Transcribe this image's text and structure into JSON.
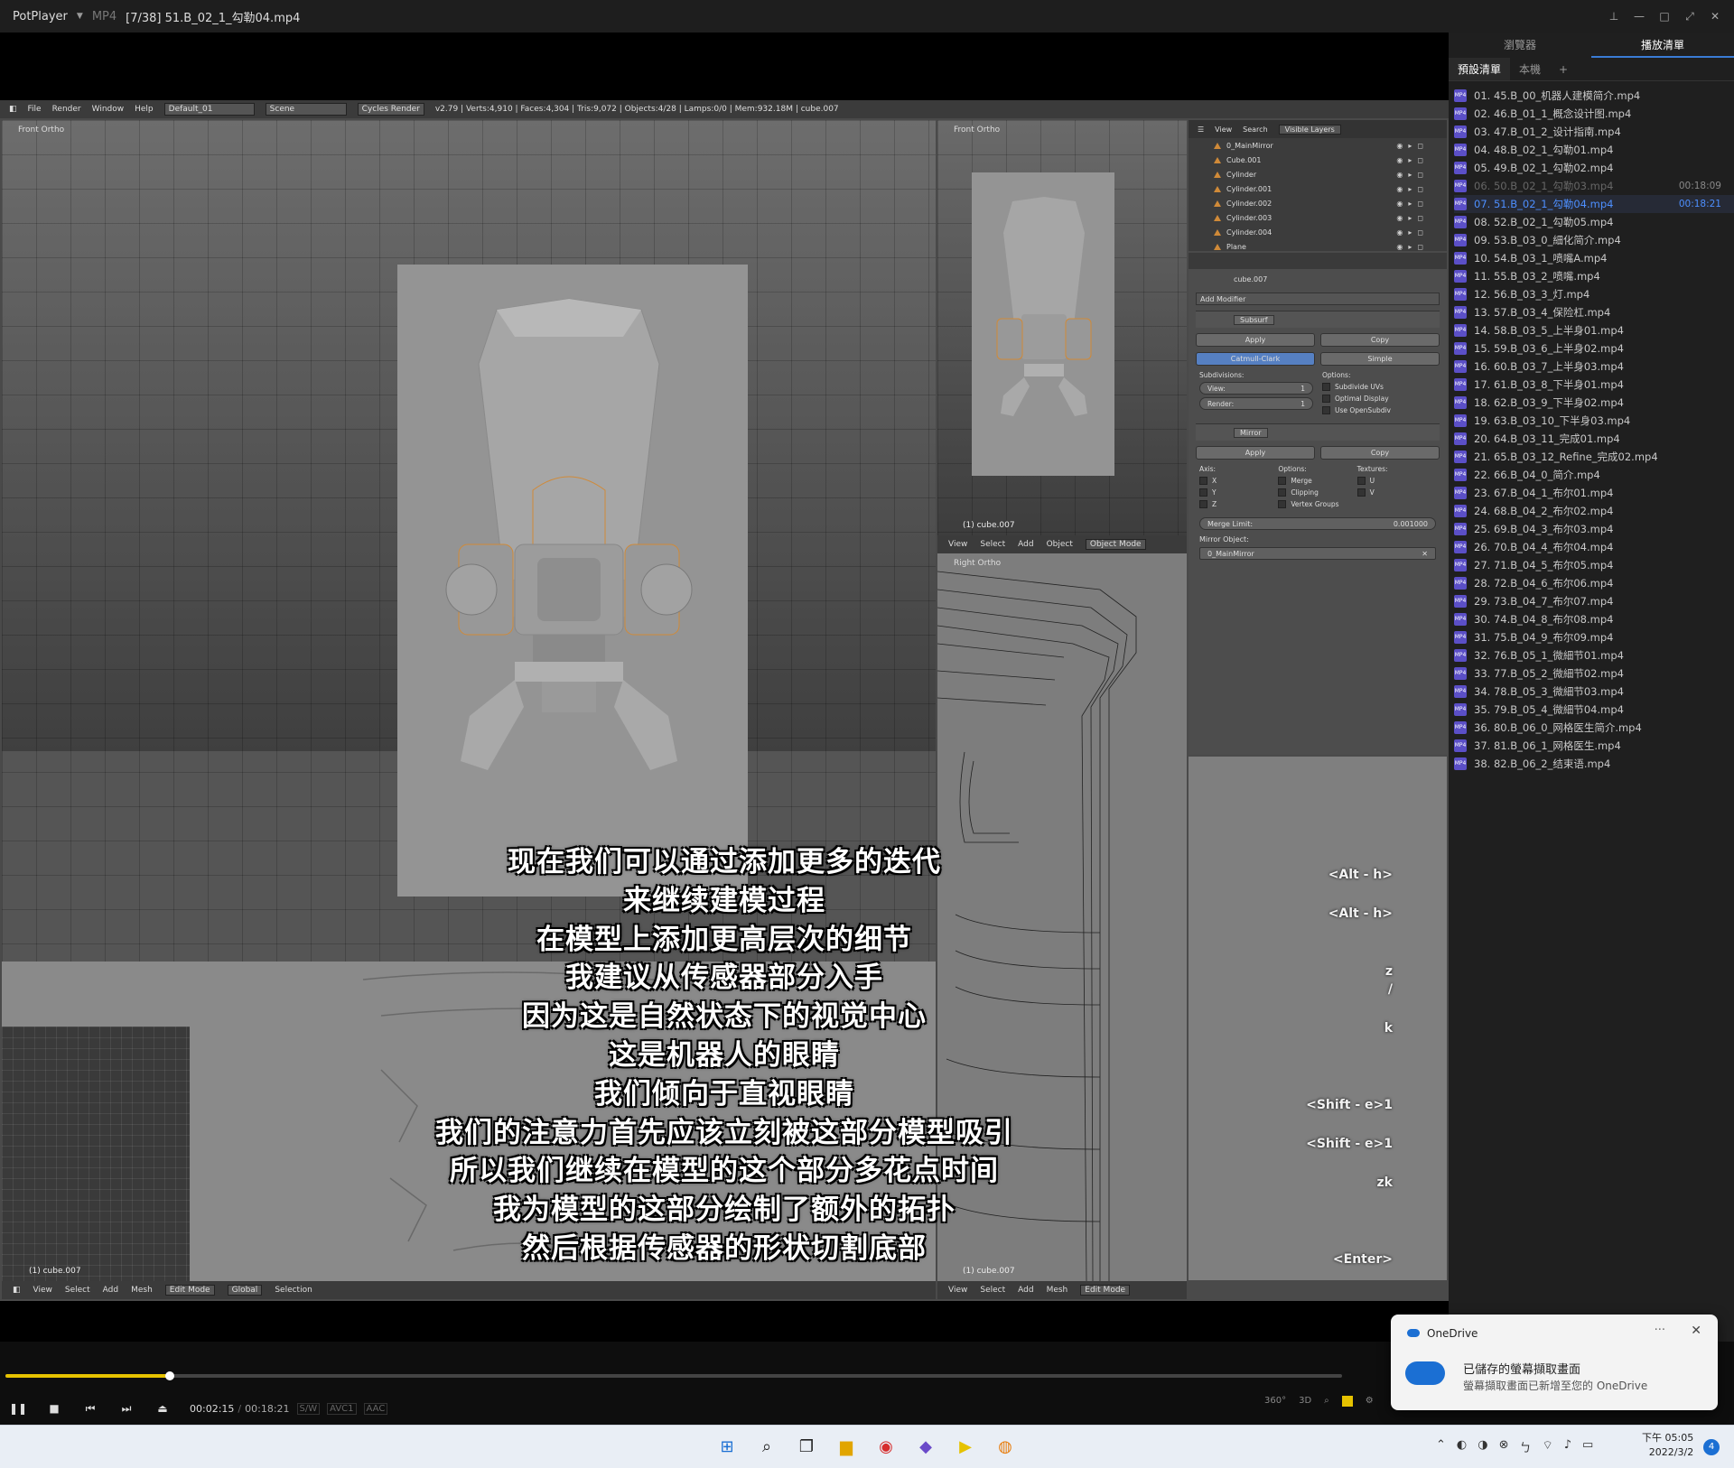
{
  "titlebar": {
    "app_name": "PotPlayer",
    "format": "MP4",
    "file_title": "[7/38] 51.B_02_1_勾勒04.mp4"
  },
  "blender": {
    "header": {
      "menus": [
        "File",
        "Render",
        "Window",
        "Help"
      ],
      "screen": "Default_01",
      "scene": "Scene",
      "engine": "Cycles Render",
      "stats": "v2.79 | Verts:4,910 | Faces:4,304 | Tris:9,072 | Objects:4/28 | Lamps:0/0 | Mem:932.18M | cube.007"
    },
    "viewport_main_label": "Front Ortho",
    "viewport_side_label": "Front Ortho",
    "viewport_side_footer": "(1) cube.007",
    "viewport_right_label": "Right Ortho",
    "viewport_right_footer": "(1) cube.007",
    "small_viewport_footer": "(1) cube.007",
    "right_viewport_header": {
      "items": [
        "View",
        "Select",
        "Add",
        "Object"
      ],
      "mode": "Object Mode"
    },
    "bottom_header": {
      "items": [
        "View",
        "Select",
        "Add",
        "Mesh"
      ],
      "mode": "Edit Mode",
      "orientation": "Global",
      "selection": "Selection"
    },
    "right_bottom_header": {
      "items": [
        "View",
        "Select",
        "Add",
        "Mesh"
      ],
      "mode": "Edit Mode"
    },
    "outliner": {
      "menu": [
        "View",
        "Search"
      ],
      "filter": "Visible Layers",
      "items": [
        "0_MainMirror",
        "Cube.001",
        "Cylinder",
        "Cylinder.001",
        "Cylinder.002",
        "Cylinder.003",
        "Cylinder.004",
        "Plane"
      ]
    },
    "properties": {
      "object_name": "cube.007",
      "add_modifier": "Add Modifier",
      "subsurf": {
        "name": "Subsurf",
        "apply": "Apply",
        "copy": "Copy",
        "mode_a": "Catmull-Clark",
        "mode_b": "Simple",
        "subdivisions_label": "Subdivisions:",
        "view_label": "View:",
        "view_value": "1",
        "render_label": "Render:",
        "render_value": "1",
        "options_label": "Options:",
        "opt1": "Subdivide UVs",
        "opt2": "Optimal Display",
        "opt3": "Use OpenSubdiv"
      },
      "mirror": {
        "name": "Mirror",
        "apply": "Apply",
        "copy": "Copy",
        "axis_label": "Axis:",
        "options_label": "Options:",
        "textures_label": "Textures:",
        "axes": [
          "X",
          "Y",
          "Z"
        ],
        "options": [
          "Merge",
          "Clipping",
          "Vertex Groups"
        ],
        "textures": [
          "U",
          "V"
        ],
        "merge_limit_label": "Merge Limit:",
        "merge_limit_value": "0.001000",
        "mirror_object_label": "Mirror Object:",
        "mirror_object_value": "0_MainMirror"
      }
    },
    "shortcuts": [
      "<Alt - h>",
      "<Alt - h>",
      "z",
      "/",
      "k",
      "<Shift - e>1",
      "<Shift - e>1",
      "zk",
      "<Enter>"
    ]
  },
  "subtitles": [
    "现在我们可以通过添加更多的迭代",
    "来继续建模过程",
    "在模型上添加更高层次的细节",
    "我建议从传感器部分入手",
    "因为这是自然状态下的视觉中心",
    "这是机器人的眼睛",
    "我们倾向于直视眼睛",
    "我们的注意力首先应该立刻被这部分模型吸引",
    "所以我们继续在模型的这个部分多花点时间",
    "我为模型的这部分绘制了额外的拓扑",
    "然后根据传感器的形状切割底部"
  ],
  "playlist": {
    "tabs": [
      "瀏覽器",
      "播放清單"
    ],
    "active_tab": 1,
    "subtabs": [
      "預設清單",
      "本機",
      "+"
    ],
    "items": [
      {
        "name": "01. 45.B_00_机器人建模简介.mp4",
        "duration": ""
      },
      {
        "name": "02. 46.B_01_1_概念设计图.mp4",
        "duration": ""
      },
      {
        "name": "03. 47.B_01_2_设计指南.mp4",
        "duration": ""
      },
      {
        "name": "04. 48.B_02_1_勾勒01.mp4",
        "duration": ""
      },
      {
        "name": "05. 49.B_02_1_勾勒02.mp4",
        "duration": ""
      },
      {
        "name": "06. 50.B_02_1_勾勒03.mp4",
        "duration": "00:18:09"
      },
      {
        "name": "07. 51.B_02_1_勾勒04.mp4",
        "duration": "00:18:21"
      },
      {
        "name": "08. 52.B_02_1_勾勒05.mp4",
        "duration": ""
      },
      {
        "name": "09. 53.B_03_0_細化简介.mp4",
        "duration": ""
      },
      {
        "name": "10. 54.B_03_1_喷嘴A.mp4",
        "duration": ""
      },
      {
        "name": "11. 55.B_03_2_喷嘴.mp4",
        "duration": ""
      },
      {
        "name": "12. 56.B_03_3_灯.mp4",
        "duration": ""
      },
      {
        "name": "13. 57.B_03_4_保险杠.mp4",
        "duration": ""
      },
      {
        "name": "14. 58.B_03_5_上半身01.mp4",
        "duration": ""
      },
      {
        "name": "15. 59.B_03_6_上半身02.mp4",
        "duration": ""
      },
      {
        "name": "16. 60.B_03_7_上半身03.mp4",
        "duration": ""
      },
      {
        "name": "17. 61.B_03_8_下半身01.mp4",
        "duration": ""
      },
      {
        "name": "18. 62.B_03_9_下半身02.mp4",
        "duration": ""
      },
      {
        "name": "19. 63.B_03_10_下半身03.mp4",
        "duration": ""
      },
      {
        "name": "20. 64.B_03_11_完成01.mp4",
        "duration": ""
      },
      {
        "name": "21. 65.B_03_12_Refine_完成02.mp4",
        "duration": ""
      },
      {
        "name": "22. 66.B_04_0_简介.mp4",
        "duration": ""
      },
      {
        "name": "23. 67.B_04_1_布尔01.mp4",
        "duration": ""
      },
      {
        "name": "24. 68.B_04_2_布尔02.mp4",
        "duration": ""
      },
      {
        "name": "25. 69.B_04_3_布尔03.mp4",
        "duration": ""
      },
      {
        "name": "26. 70.B_04_4_布尔04.mp4",
        "duration": ""
      },
      {
        "name": "27. 71.B_04_5_布尔05.mp4",
        "duration": ""
      },
      {
        "name": "28. 72.B_04_6_布尔06.mp4",
        "duration": ""
      },
      {
        "name": "29. 73.B_04_7_布尔07.mp4",
        "duration": ""
      },
      {
        "name": "30. 74.B_04_8_布尔08.mp4",
        "duration": ""
      },
      {
        "name": "31. 75.B_04_9_布尔09.mp4",
        "duration": ""
      },
      {
        "name": "32. 76.B_05_1_微細节01.mp4",
        "duration": ""
      },
      {
        "name": "33. 77.B_05_2_微細节02.mp4",
        "duration": ""
      },
      {
        "name": "34. 78.B_05_3_微細节03.mp4",
        "duration": ""
      },
      {
        "name": "35. 79.B_05_4_微細节04.mp4",
        "duration": ""
      },
      {
        "name": "36. 80.B_06_0_网格医生简介.mp4",
        "duration": ""
      },
      {
        "name": "37. 81.B_06_1_网格医生.mp4",
        "duration": ""
      },
      {
        "name": "38. 82.B_06_2_结束语.mp4",
        "duration": ""
      }
    ],
    "current_index": 6
  },
  "controls": {
    "time_current": "00:02:15",
    "time_separator": "/",
    "time_total": "00:18:21",
    "progress": 0.123,
    "tags": [
      "S/W",
      "AVC1",
      "AAC"
    ],
    "right_labels": [
      "360°",
      "3D"
    ]
  },
  "toast": {
    "app": "OneDrive",
    "title": "已儲存的螢幕擷取畫面",
    "body": "螢幕擷取畫面已新增至您的 OneDrive"
  },
  "taskbar": {
    "time": "下午 05:05",
    "date": "2022/3/2",
    "notifications": "4"
  },
  "colors": {
    "accent_blue": "#4d8fff",
    "seek_yellow": "#e6c200",
    "blender_select": "#5680c2",
    "outline_orange": "#d08a38"
  }
}
